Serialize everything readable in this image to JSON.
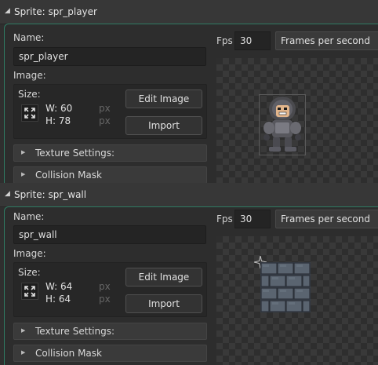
{
  "sprites": [
    {
      "title": "Sprite: spr_player",
      "name_label": "Name:",
      "name_value": "spr_player",
      "image_label": "Image:",
      "size_label": "Size:",
      "width": "W: 60",
      "height": "H: 78",
      "unit": "px",
      "edit_image_label": "Edit Image",
      "import_label": "Import",
      "texture_settings_label": "Texture Settings:",
      "collision_mask_label": "Collision Mask",
      "fps_label": "Fps",
      "fps_value": "30",
      "fps_mode": "Frames per second",
      "preview_icon": "knight-sprite"
    },
    {
      "title": "Sprite: spr_wall",
      "name_label": "Name:",
      "name_value": "spr_wall",
      "image_label": "Image:",
      "size_label": "Size:",
      "width": "W: 64",
      "height": "H: 64",
      "unit": "px",
      "edit_image_label": "Edit Image",
      "import_label": "Import",
      "texture_settings_label": "Texture Settings:",
      "collision_mask_label": "Collision Mask",
      "fps_label": "Fps",
      "fps_value": "30",
      "fps_mode": "Frames per second",
      "preview_icon": "stone-brick-wall-sprite"
    }
  ],
  "colors": {
    "accent": "#2f7b63",
    "background": "#2f2f2f",
    "checker_dark": "#2e2e2e",
    "checker_light": "#393939"
  }
}
